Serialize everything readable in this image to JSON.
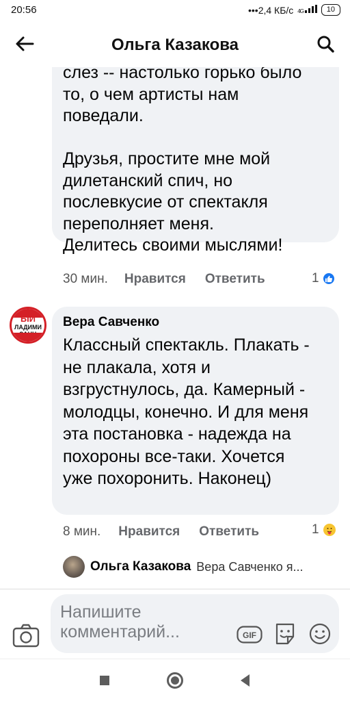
{
  "status_bar": {
    "time": "20:56",
    "network_speed": "2,4 КБ/с",
    "network_type": "4G",
    "battery": "10"
  },
  "header": {
    "title": "Ольга Казакова",
    "back_icon": "arrow-left-icon",
    "search_icon": "search-icon"
  },
  "comments": [
    {
      "text": "слез -- настолько горько было\nто, о чем артисты нам\nповедали.\n\nДрузья, простите мне мой\nдилетанский спич, но\nпослевкусие от спектакля\nпереполняет меня.\nДелитесь своими мыслями!",
      "time": "30 мин.",
      "like_label": "Нравится",
      "reply_label": "Ответить",
      "reaction_count": "1",
      "reaction_icon": "like-reaction-icon"
    },
    {
      "author": "Вера Савченко",
      "avatar_text": [
        "ЫЙ",
        "ЛАДИМИ",
        "ЗАНЦ"
      ],
      "text": "Классный спектакль. Плакать -\nне плакала, хотя и\nвзгрустнулось, да. Камерный -\nмолодцы, конечно. И для меня\nэта постановка - надежда на\nпохороны все-таки. Хочется\nуже похоронить. Наконец)",
      "time": "8 мин.",
      "like_label": "Нравится",
      "reply_label": "Ответить",
      "reaction_count": "1",
      "reaction_icon": "care-reaction-icon"
    }
  ],
  "reply_preview": {
    "author": "Ольга Казакова",
    "text": "Вера Савченко я..."
  },
  "composer": {
    "placeholder": "Напишите\nкомментарий...",
    "camera_icon": "camera-icon",
    "gif_label": "GIF",
    "sticker_icon": "sticker-icon",
    "emoji_icon": "emoji-icon"
  },
  "colors": {
    "accent": "#1877f2",
    "bubble": "#f0f2f5",
    "secondary_text": "#65676b"
  }
}
